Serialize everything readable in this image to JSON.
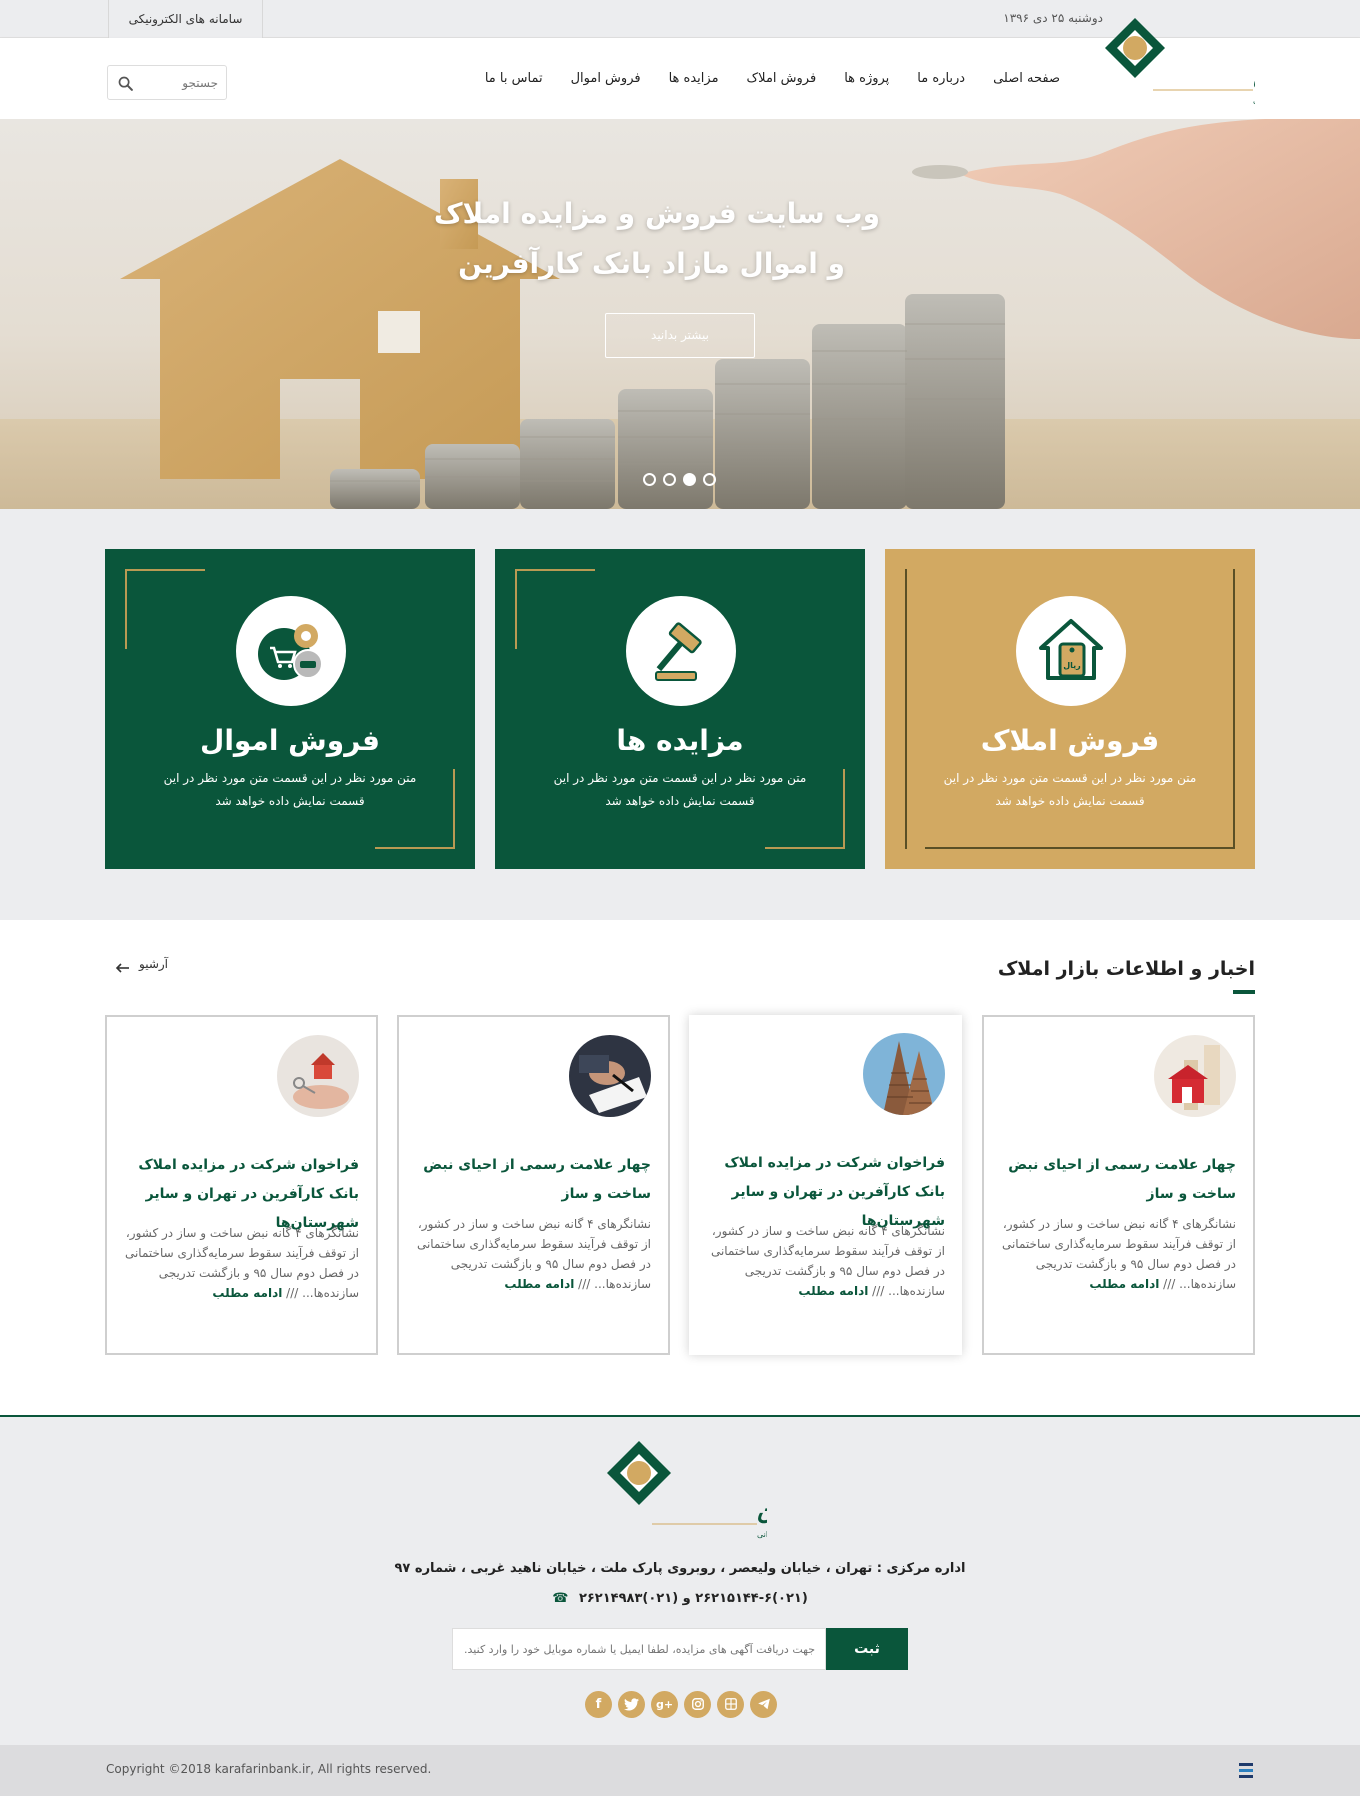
{
  "topbar": {
    "date": "دوشنبه ۲۵ دی ۱۳۹۶",
    "e_systems": "سامانه های الکترونیکی"
  },
  "logo": {
    "name": "بانک کارآفرین",
    "tagline": "دانش جهانی، راه‌حل ایرانی"
  },
  "nav": {
    "items": [
      "صفحه اصلی",
      "درباره ما",
      "پروژه ها",
      "فروش املاک",
      "مزایده ها",
      "فروش اموال",
      "تماس با ما"
    ]
  },
  "search": {
    "placeholder": "جستجو"
  },
  "hero": {
    "title_line1": "وب سایت فروش و مزایده املاک",
    "title_line2": "و اموال مازاد بانک کارآفرین",
    "button": "بیشتر بدانید",
    "slides": 4,
    "active_slide": 2
  },
  "services": [
    {
      "title": "فروش املاک",
      "text": "متن مورد نظر در این قسمت متن مورد نظر در این قسمت نمایش داده خواهد شد",
      "icon": "house-price-tag-icon",
      "color": "#d2a962"
    },
    {
      "title": "مزایده ها",
      "text": "متن مورد نظر در این قسمت متن مورد نظر در این قسمت نمایش داده خواهد شد",
      "icon": "gavel-icon",
      "color": "#0a563b"
    },
    {
      "title": "فروش اموال",
      "text": "متن مورد نظر در این قسمت متن مورد نظر در این قسمت نمایش داده خواهد شد",
      "icon": "shopping-cart-car-icon",
      "color": "#0a563b"
    }
  ],
  "news": {
    "title": "اخبار و اطلاعات بازار املاک",
    "archive": "آرشیو",
    "read_more": "ادامه مطلب",
    "items": [
      {
        "title": "چهار علامت رسمی از احیای نبض ساخت و ساز",
        "text": "نشانگرهای ۴ گانه نبض ساخت و ساز در کشور، از توقف فرآیند سقوط سرمایه‌گذاری ساختمانی در فصل دوم سال ۹۵ و بازگشت تدریجی سازنده‌ها...",
        "image": "house-model-image"
      },
      {
        "title": "فراخوان شرکت در مزایده املاک بانک کارآفرین در تهران و سایر شهرستان‌ها",
        "text": "نشانگرهای ۴ گانه نبض ساخت و ساز در کشور، از توقف فرآیند سقوط سرمایه‌گذاری ساختمانی در فصل دوم سال ۹۵ و بازگشت تدریجی سازنده‌ها...",
        "image": "building-image"
      },
      {
        "title": "چهار علامت رسمی از احیای نبض ساخت و ساز",
        "text": "نشانگرهای ۴ گانه نبض ساخت و ساز در کشور، از توقف فرآیند سقوط سرمایه‌گذاری ساختمانی در فصل دوم سال ۹۵ و بازگشت تدریجی سازنده‌ها...",
        "image": "signing-contract-image"
      },
      {
        "title": "فراخوان شرکت در مزایده املاک بانک کارآفرین در تهران و سایر شهرستان‌ها",
        "text": "نشانگرهای ۴ گانه نبض ساخت و ساز در کشور، از توقف فرآیند سقوط سرمایه‌گذاری ساختمانی در فصل دوم سال ۹۵ و بازگشت تدریجی سازنده‌ها...",
        "image": "house-keys-image"
      }
    ]
  },
  "footer": {
    "address": "اداره مرکزی : تهران ، خیابان ولیعصر ، روبروی پارک ملت ، خیابان ناهید غربی ، شماره ۹۷",
    "phone": "(۰۲۱)۲۶۲۱۵۱۴۴-۶  و  (۰۲۱)۲۶۲۱۴۹۸۳",
    "subscribe_placeholder": "جهت دریافت آگهی های مزایده، لطفا ایمیل یا شماره موبایل خود را وارد کنید.",
    "subscribe_button": "ثبت",
    "socials": [
      "facebook-icon",
      "twitter-icon",
      "google-plus-icon",
      "instagram-icon",
      "aparat-icon",
      "telegram-icon"
    ],
    "copyright": "Copyright ©2018 karafarinbank.ir, All rights reserved."
  },
  "colors": {
    "brand_green": "#0a563b",
    "brand_gold": "#d2a962"
  }
}
